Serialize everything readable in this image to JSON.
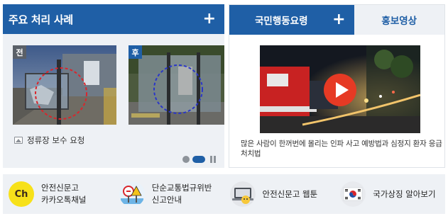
{
  "left_panel": {
    "title": "주요 처리 사례",
    "plus": "+",
    "before_tag": "전",
    "after_tag": "후",
    "caption": "정류장 보수 요청",
    "pager": {
      "total": 2,
      "active_index": 1
    }
  },
  "right_panel": {
    "tabs": [
      {
        "label": "국민행동요령",
        "active": true
      },
      {
        "label": "홍보영상",
        "active": false
      }
    ],
    "plus": "+",
    "video_description": "많은 사람이 한꺼번에 몰리는 인파 사고 예방법과 심정지 환자 응급처치법"
  },
  "bottom_links": [
    {
      "icon": "kakao-channel-icon",
      "icon_text": "Ch",
      "line1": "안전신문고",
      "line2": "카카오톡채널"
    },
    {
      "icon": "traffic-sign-icon",
      "line1": "단순교통법규위반",
      "line2": "신고안내"
    },
    {
      "icon": "laptop-webtoon-icon",
      "line1": "안전신문고 웹툰",
      "line2": ""
    },
    {
      "icon": "korean-flag-icon",
      "line1": "국가상징 알아보기",
      "line2": ""
    }
  ],
  "colors": {
    "primary": "#1f5fa6",
    "panel_bg": "#eef1f5",
    "kakao_yellow": "#f7e11a",
    "before_circle": "#d9262c",
    "after_circle": "#2a36c8",
    "play_button": "#e63a24"
  }
}
